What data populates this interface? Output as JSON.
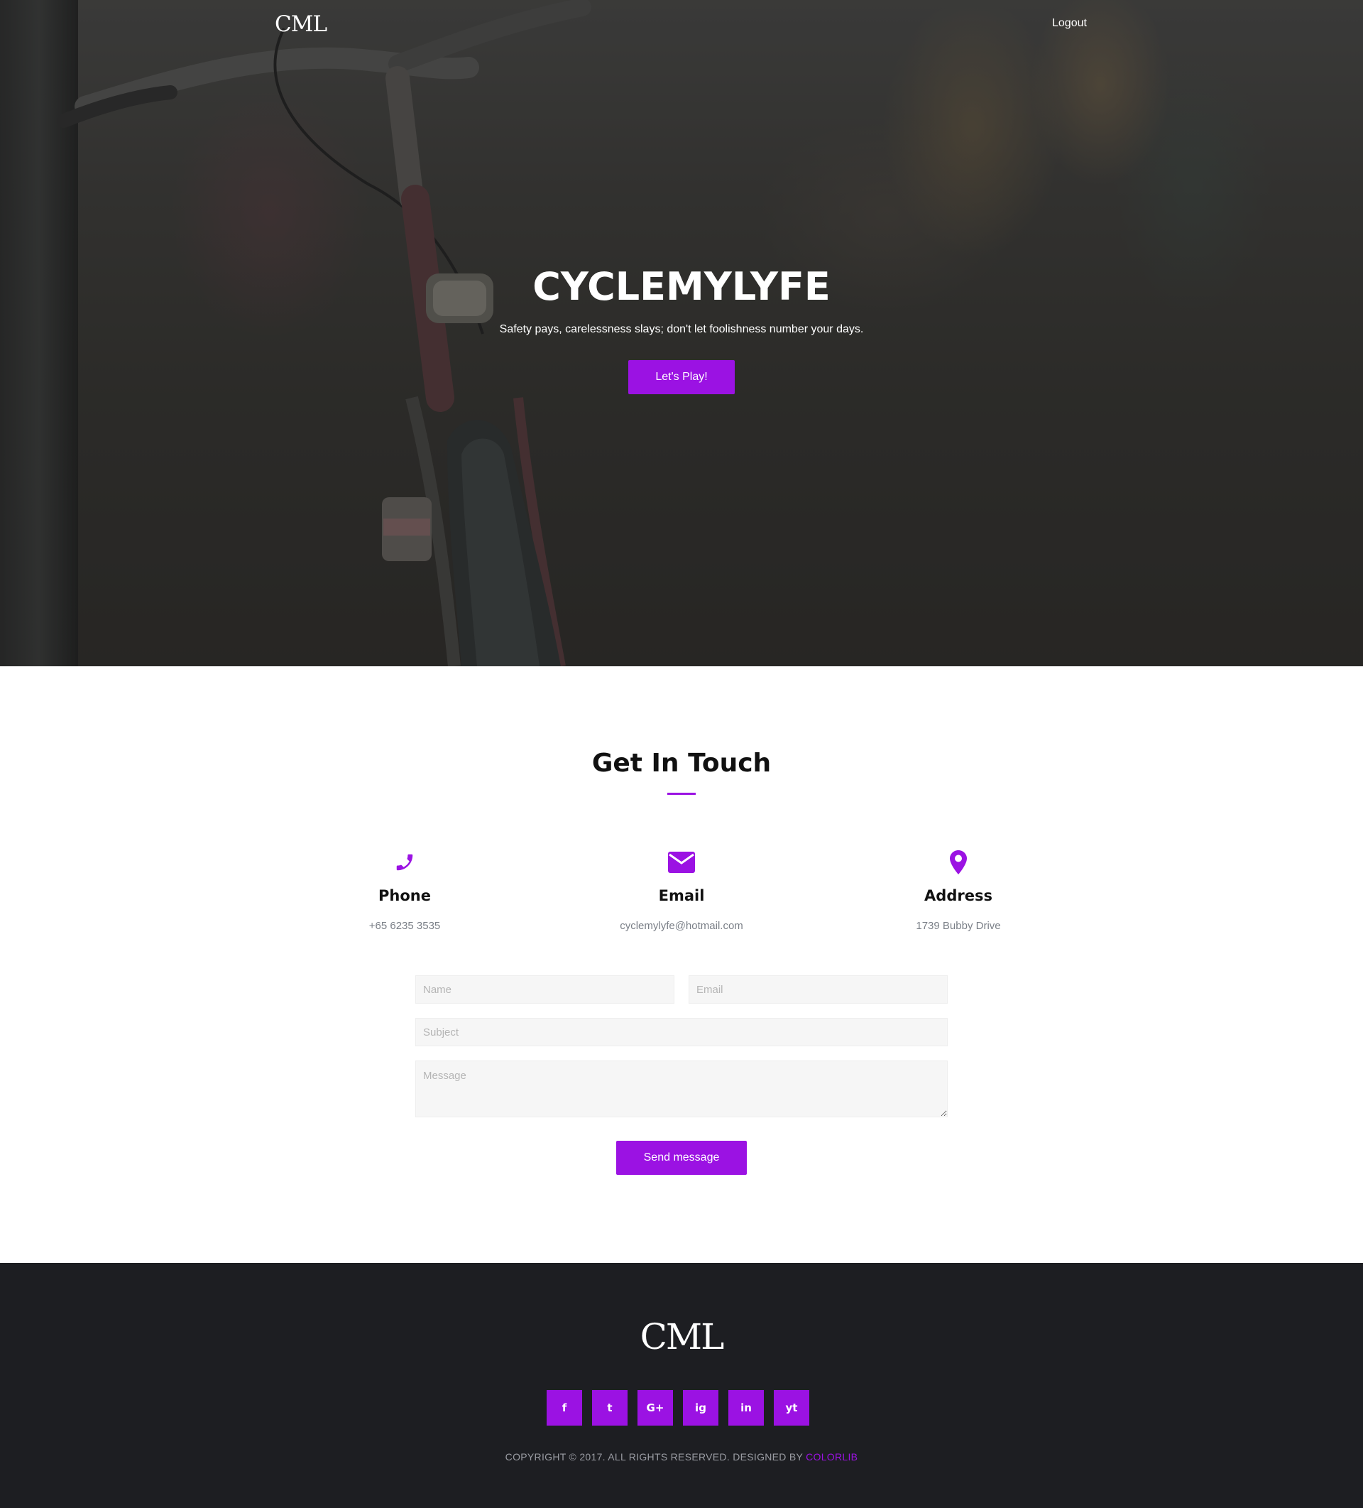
{
  "colors": {
    "accent": "#9b12e3",
    "footer_bg": "#1d1e22",
    "muted_text": "#7a7f87"
  },
  "nav": {
    "logo": "CML",
    "logout_label": "Logout"
  },
  "hero": {
    "title": "CYCLEMYLYFE",
    "subtitle": "Safety pays, carelessness slays; don't let foolishness number your days.",
    "button_label": "Let's Play!"
  },
  "contact": {
    "title": "Get In Touch",
    "items": [
      {
        "icon": "phone-icon",
        "label": "Phone",
        "value": "+65 6235 3535"
      },
      {
        "icon": "envelope-icon",
        "label": "Email",
        "value": "cyclemylyfe@hotmail.com"
      },
      {
        "icon": "map-marker-icon",
        "label": "Address",
        "value": "1739 Bubby Drive"
      }
    ],
    "form": {
      "name_placeholder": "Name",
      "email_placeholder": "Email",
      "subject_placeholder": "Subject",
      "message_placeholder": "Message",
      "send_label": "Send message"
    }
  },
  "footer": {
    "logo": "CML",
    "socials": [
      {
        "icon": "facebook-icon",
        "glyph": "f"
      },
      {
        "icon": "twitter-icon",
        "glyph": "t"
      },
      {
        "icon": "google-plus-icon",
        "glyph": "G+"
      },
      {
        "icon": "instagram-icon",
        "glyph": "ig"
      },
      {
        "icon": "linkedin-icon",
        "glyph": "in"
      },
      {
        "icon": "youtube-icon",
        "glyph": "yt"
      }
    ],
    "copyright_text": "COPYRIGHT © 2017. ALL RIGHTS RESERVED. DESIGNED BY ",
    "copyright_link": "COLORLIB"
  }
}
